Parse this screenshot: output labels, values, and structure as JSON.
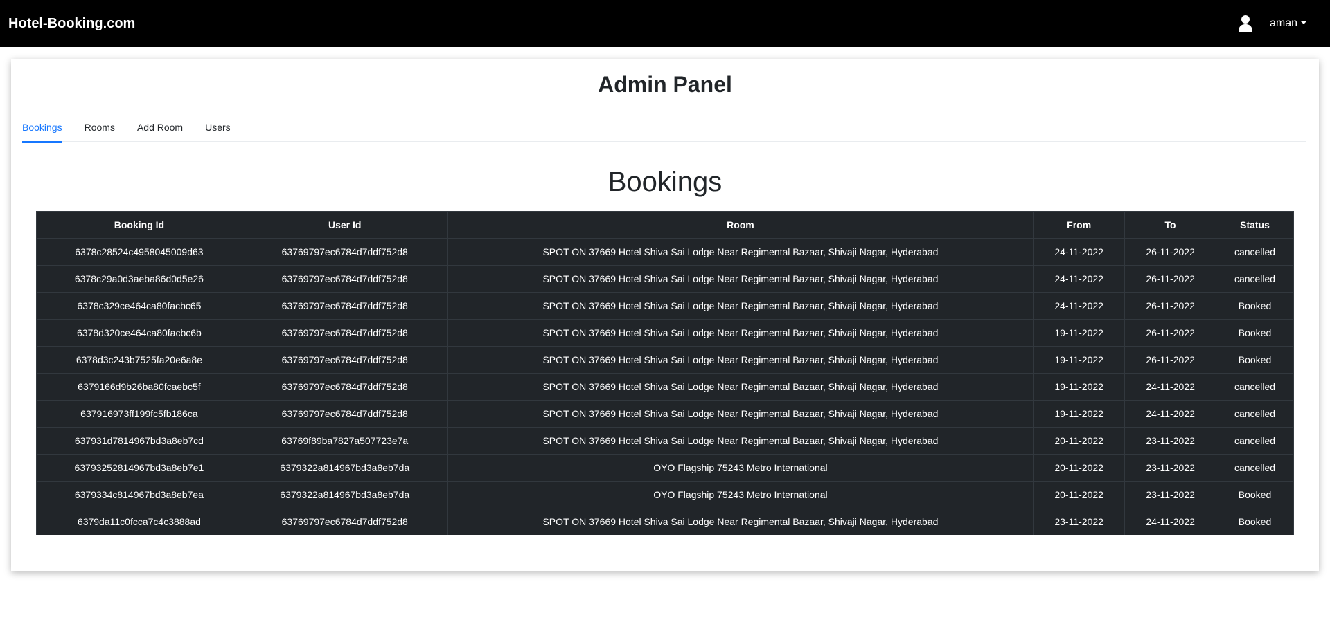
{
  "navbar": {
    "brand": "Hotel-Booking.com",
    "user_name": "aman",
    "user_icon": "user-icon"
  },
  "panel": {
    "title": "Admin Panel",
    "tabs": [
      {
        "label": "Bookings",
        "active": true
      },
      {
        "label": "Rooms",
        "active": false
      },
      {
        "label": "Add Room",
        "active": false
      },
      {
        "label": "Users",
        "active": false
      }
    ],
    "accent_color": "#1677ff"
  },
  "bookings": {
    "title": "Bookings",
    "columns": [
      "Booking Id",
      "User Id",
      "Room",
      "From",
      "To",
      "Status"
    ],
    "rows": [
      [
        "6378c28524c4958045009d63",
        "63769797ec6784d7ddf752d8",
        "SPOT ON 37669 Hotel Shiva Sai Lodge Near Regimental Bazaar, Shivaji Nagar, Hyderabad",
        "24-11-2022",
        "26-11-2022",
        "cancelled"
      ],
      [
        "6378c29a0d3aeba86d0d5e26",
        "63769797ec6784d7ddf752d8",
        "SPOT ON 37669 Hotel Shiva Sai Lodge Near Regimental Bazaar, Shivaji Nagar, Hyderabad",
        "24-11-2022",
        "26-11-2022",
        "cancelled"
      ],
      [
        "6378c329ce464ca80facbc65",
        "63769797ec6784d7ddf752d8",
        "SPOT ON 37669 Hotel Shiva Sai Lodge Near Regimental Bazaar, Shivaji Nagar, Hyderabad",
        "24-11-2022",
        "26-11-2022",
        "Booked"
      ],
      [
        "6378d320ce464ca80facbc6b",
        "63769797ec6784d7ddf752d8",
        "SPOT ON 37669 Hotel Shiva Sai Lodge Near Regimental Bazaar, Shivaji Nagar, Hyderabad",
        "19-11-2022",
        "26-11-2022",
        "Booked"
      ],
      [
        "6378d3c243b7525fa20e6a8e",
        "63769797ec6784d7ddf752d8",
        "SPOT ON 37669 Hotel Shiva Sai Lodge Near Regimental Bazaar, Shivaji Nagar, Hyderabad",
        "19-11-2022",
        "26-11-2022",
        "Booked"
      ],
      [
        "6379166d9b26ba80fcaebc5f",
        "63769797ec6784d7ddf752d8",
        "SPOT ON 37669 Hotel Shiva Sai Lodge Near Regimental Bazaar, Shivaji Nagar, Hyderabad",
        "19-11-2022",
        "24-11-2022",
        "cancelled"
      ],
      [
        "637916973ff199fc5fb186ca",
        "63769797ec6784d7ddf752d8",
        "SPOT ON 37669 Hotel Shiva Sai Lodge Near Regimental Bazaar, Shivaji Nagar, Hyderabad",
        "19-11-2022",
        "24-11-2022",
        "cancelled"
      ],
      [
        "637931d7814967bd3a8eb7cd",
        "63769f89ba7827a507723e7a",
        "SPOT ON 37669 Hotel Shiva Sai Lodge Near Regimental Bazaar, Shivaji Nagar, Hyderabad",
        "20-11-2022",
        "23-11-2022",
        "cancelled"
      ],
      [
        "63793252814967bd3a8eb7e1",
        "6379322a814967bd3a8eb7da",
        "OYO Flagship 75243 Metro International",
        "20-11-2022",
        "23-11-2022",
        "cancelled"
      ],
      [
        "6379334c814967bd3a8eb7ea",
        "6379322a814967bd3a8eb7da",
        "OYO Flagship 75243 Metro International",
        "20-11-2022",
        "23-11-2022",
        "Booked"
      ],
      [
        "6379da11c0fcca7c4c3888ad",
        "63769797ec6784d7ddf752d8",
        "SPOT ON 37669 Hotel Shiva Sai Lodge Near Regimental Bazaar, Shivaji Nagar, Hyderabad",
        "23-11-2022",
        "24-11-2022",
        "Booked"
      ]
    ]
  }
}
